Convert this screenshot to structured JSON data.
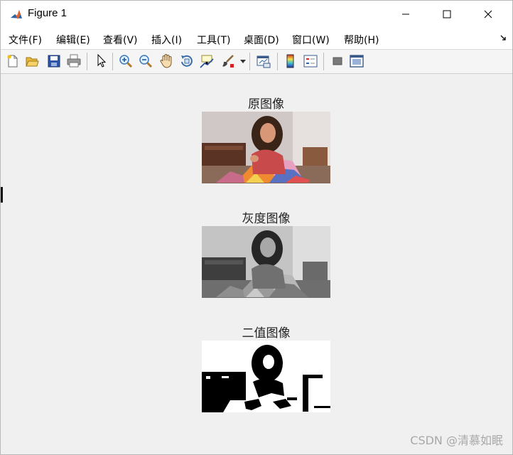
{
  "window": {
    "title": "Figure 1",
    "controls": [
      "minimize",
      "maximize",
      "close"
    ]
  },
  "menubar": {
    "items": [
      {
        "label": "文件(F)"
      },
      {
        "label": "编辑(E)"
      },
      {
        "label": "查看(V)"
      },
      {
        "label": "插入(I)"
      },
      {
        "label": "工具(T)"
      },
      {
        "label": "桌面(D)"
      },
      {
        "label": "窗口(W)"
      },
      {
        "label": "帮助(H)"
      }
    ]
  },
  "toolbar": {
    "buttons": [
      "new-figure-icon",
      "open-file-icon",
      "save-icon",
      "print-icon",
      "pointer-icon",
      "zoom-in-icon",
      "zoom-out-icon",
      "pan-hand-icon",
      "rotate-3d-icon",
      "data-cursor-icon",
      "brush-icon",
      "link-plot-icon",
      "colorbar-icon",
      "legend-icon",
      "hide-plot-tools-icon",
      "show-plot-tools-icon"
    ]
  },
  "figure": {
    "axes": [
      {
        "title": "原图像",
        "mode": "color"
      },
      {
        "title": "灰度图像",
        "mode": "grayscale"
      },
      {
        "title": "二值图像",
        "mode": "binary"
      }
    ]
  },
  "watermark": "CSDN @清慕如眠",
  "colors": {
    "background": "#f0f0f0",
    "titlebar": "#ffffff",
    "menubar": "#ffffff",
    "matlab_orange": "#e1642c",
    "matlab_blue": "#2b64a8"
  }
}
